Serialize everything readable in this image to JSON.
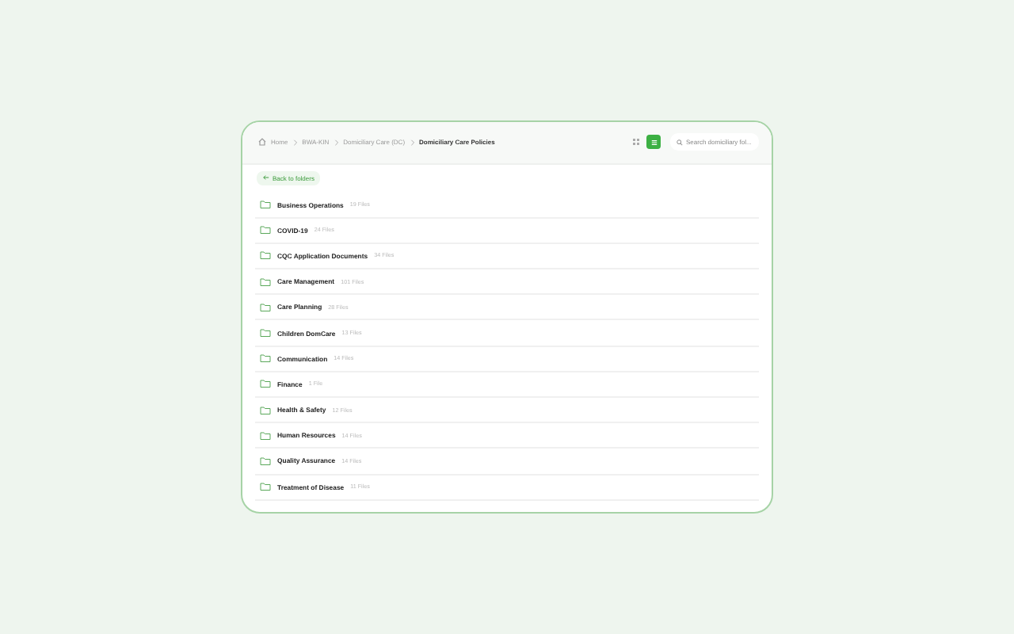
{
  "breadcrumb": [
    {
      "label": "Home",
      "kind": "home"
    },
    {
      "label": "BWA-KIN",
      "kind": "link"
    },
    {
      "label": "Domiciliary Care (DC)",
      "kind": "link"
    },
    {
      "label": "Domiciliary Care Policies",
      "kind": "current"
    }
  ],
  "search": {
    "placeholder": "Search domiciliary fol..."
  },
  "back_button": "Back to folders",
  "folders": [
    {
      "name": "Business Operations",
      "count": "19 Files"
    },
    {
      "name": "COVID-19",
      "count": "24 Files"
    },
    {
      "name": "CQC Application Documents",
      "count": "34 Files"
    },
    {
      "name": "Care Management",
      "count": "101 Files"
    },
    {
      "name": "Care Planning",
      "count": "28 Files"
    },
    {
      "name": "Children DomCare",
      "count": "13 Files"
    },
    {
      "name": "Communication",
      "count": "14 Files"
    },
    {
      "name": "Finance",
      "count": "1 File"
    },
    {
      "name": "Health & Safety",
      "count": "12 Files"
    },
    {
      "name": "Human Resources",
      "count": "14 Files"
    },
    {
      "name": "Quality Assurance",
      "count": "14 Files"
    },
    {
      "name": "Treatment of Disease",
      "count": "11 Files"
    }
  ]
}
